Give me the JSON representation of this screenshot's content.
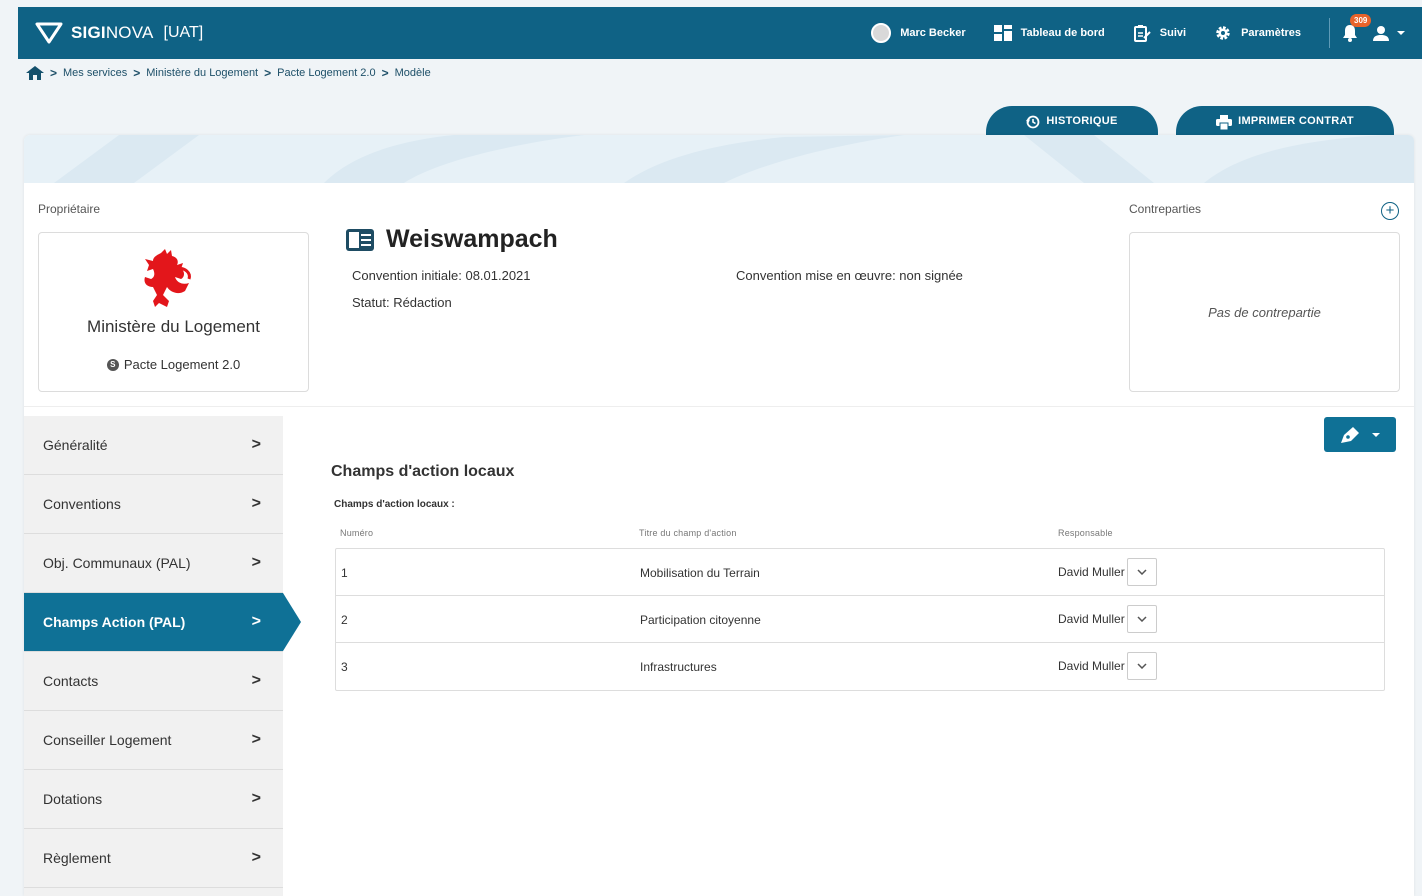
{
  "header": {
    "brand_strong": "SIGI",
    "brand_light": "NOVA",
    "env": "[UAT]",
    "user_name": "Marc Becker",
    "nav": [
      {
        "label": "Tableau de bord",
        "icon": "dashboard-icon"
      },
      {
        "label": "Suivi",
        "icon": "clipboard-icon"
      },
      {
        "label": "Paramètres",
        "icon": "gear-icon"
      }
    ],
    "notification_count": "309"
  },
  "breadcrumb": [
    "Mes services",
    "Ministère du Logement",
    "Pacte Logement 2.0",
    "Modèle"
  ],
  "actions": {
    "history_label": "HISTORIQUE",
    "print_label": "IMPRIMER CONTRAT"
  },
  "owner": {
    "section_label": "Propriétaire",
    "name": "Ministère du Logement",
    "program": "Pacte Logement 2.0"
  },
  "record": {
    "title": "Weiswampach",
    "convention_initiale": "Convention initiale: 08.01.2021",
    "convention_mise": "Convention mise en œuvre: non signée",
    "statut": "Statut: Rédaction"
  },
  "contreparties": {
    "section_label": "Contreparties",
    "empty_text": "Pas de contrepartie"
  },
  "sidebar": {
    "items": [
      {
        "label": "Généralité",
        "active": false
      },
      {
        "label": "Conventions",
        "active": false
      },
      {
        "label": "Obj. Communaux (PAL)",
        "active": false
      },
      {
        "label": "Champs Action (PAL)",
        "active": true
      },
      {
        "label": "Contacts",
        "active": false
      },
      {
        "label": "Conseiller Logement",
        "active": false
      },
      {
        "label": "Dotations",
        "active": false
      },
      {
        "label": "Règlement",
        "active": false
      }
    ]
  },
  "content": {
    "title": "Champs d'action locaux",
    "subtitle": "Champs d'action locaux :",
    "columns": [
      "Numéro",
      "Titre du champ d'action",
      "Responsable"
    ],
    "rows": [
      {
        "numero": "1",
        "titre": "Mobilisation du Terrain",
        "responsable": "David Muller"
      },
      {
        "numero": "2",
        "titre": "Participation citoyenne",
        "responsable": "David Muller"
      },
      {
        "numero": "3",
        "titre": "Infrastructures",
        "responsable": "David Muller"
      }
    ]
  },
  "colors": {
    "primary": "#0f6285",
    "active": "#0f7196",
    "badge": "#e8632b",
    "lion": "#e3161b"
  }
}
